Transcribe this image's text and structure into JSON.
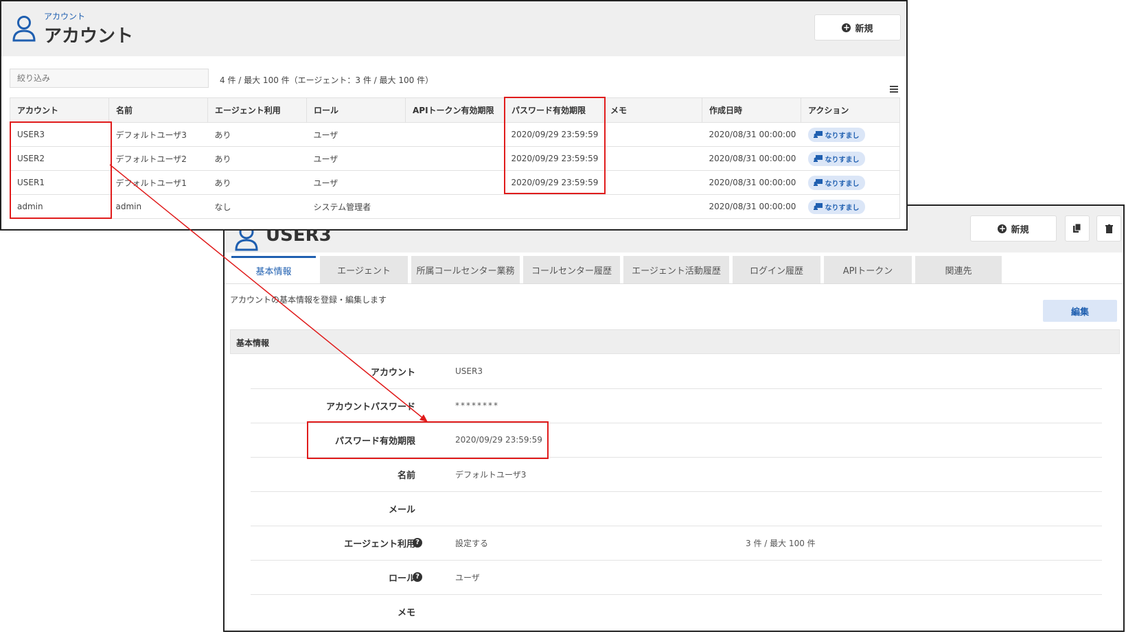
{
  "detail": {
    "title": "USER3",
    "new_label": "新規",
    "tabs": [
      {
        "label": "基本情報"
      },
      {
        "label": "エージェント"
      },
      {
        "label": "所属コールセンター業務"
      },
      {
        "label": "コールセンター履歴"
      },
      {
        "label": "エージェント活動履歴"
      },
      {
        "label": "ログイン履歴"
      },
      {
        "label": "APIトークン"
      },
      {
        "label": "関連先"
      }
    ],
    "description": "アカウントの基本情報を登録・編集します",
    "edit_label": "編集",
    "section_title": "基本情報",
    "fields": [
      {
        "label": "アカウント",
        "value": "USER3"
      },
      {
        "label": "アカウントパスワード",
        "value": "********"
      },
      {
        "label": "パスワード有効期限",
        "value": "2020/09/29 23:59:59"
      },
      {
        "label": "名前",
        "value": "デフォルトユーザ3"
      },
      {
        "label": "メール",
        "value": ""
      },
      {
        "label": "エージェント利用",
        "value": "設定する",
        "extra": "3 件 / 最大 100 件"
      },
      {
        "label": "ロール",
        "value": "ユーザ"
      },
      {
        "label": "メモ",
        "value": ""
      }
    ]
  },
  "list": {
    "breadcrumb": "アカウント",
    "title": "アカウント",
    "new_label": "新規",
    "filter_placeholder": "絞り込み",
    "count_text": "4 件 / 最大 100 件（エージェント：3 件 / 最大 100 件）",
    "columns": [
      "アカウント",
      "名前",
      "エージェント利用",
      "ロール",
      "APIトークン有効期限",
      "パスワード有効期限",
      "メモ",
      "作成日時",
      "アクション"
    ],
    "rows": [
      {
        "account": "USER3",
        "name": "デフォルトユーザ3",
        "agent": "あり",
        "role": "ユーザ",
        "api_expiry": "",
        "pw_expiry": "2020/09/29 23:59:59",
        "memo": "",
        "created": "2020/08/31 00:00:00",
        "action": "なりすまし"
      },
      {
        "account": "USER2",
        "name": "デフォルトユーザ2",
        "agent": "あり",
        "role": "ユーザ",
        "api_expiry": "",
        "pw_expiry": "2020/09/29 23:59:59",
        "memo": "",
        "created": "2020/08/31 00:00:00",
        "action": "なりすまし"
      },
      {
        "account": "USER1",
        "name": "デフォルトユーザ1",
        "agent": "あり",
        "role": "ユーザ",
        "api_expiry": "",
        "pw_expiry": "2020/09/29 23:59:59",
        "memo": "",
        "created": "2020/08/31 00:00:00",
        "action": "なりすまし"
      },
      {
        "account": "admin",
        "name": "admin",
        "agent": "なし",
        "role": "システム管理者",
        "api_expiry": "",
        "pw_expiry": "",
        "memo": "",
        "created": "2020/08/31 00:00:00",
        "action": "なりすまし"
      }
    ]
  },
  "colors": {
    "accent": "#1f5fb0",
    "highlight": "#e01b1b",
    "header_bg": "#efefef",
    "pill_bg": "#dbe6f7"
  },
  "icons": [
    "user-icon",
    "plus-circle-icon",
    "copy-icon",
    "trash-icon",
    "question-icon",
    "menu-icon",
    "impersonate-icon"
  ]
}
